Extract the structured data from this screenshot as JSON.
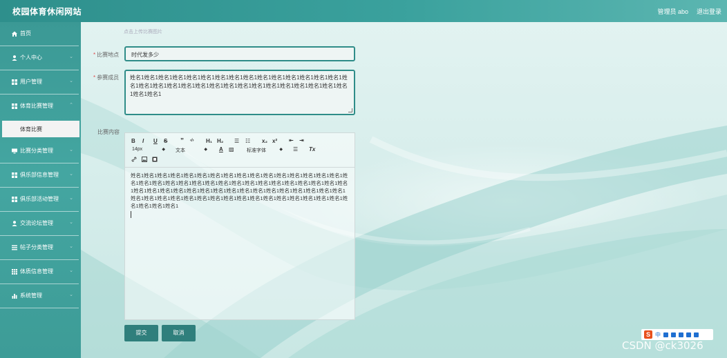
{
  "header": {
    "site_title": "校园体育休闲网站",
    "admin_label": "管理员 abo",
    "logout": "退出登录"
  },
  "sidebar": {
    "items": [
      {
        "label": "首页",
        "icon": "home-icon",
        "arrow": ""
      },
      {
        "label": "个人中心",
        "icon": "user-icon",
        "arrow": "⌄"
      },
      {
        "label": "用户管理",
        "icon": "grid-icon",
        "arrow": "⌄"
      },
      {
        "label": "体育比赛管理",
        "icon": "grid-icon",
        "arrow": "⌃"
      },
      {
        "label": "比赛分类管理",
        "icon": "monitor-icon",
        "arrow": "⌄"
      },
      {
        "label": "俱乐部信息管理",
        "icon": "grid-icon",
        "arrow": "⌄"
      },
      {
        "label": "俱乐部活动管理",
        "icon": "grid-icon",
        "arrow": "⌄"
      },
      {
        "label": "交流论坛管理",
        "icon": "user-icon",
        "arrow": "⌄"
      },
      {
        "label": "帖子分类管理",
        "icon": "list-icon",
        "arrow": "⌄"
      },
      {
        "label": "体质信息管理",
        "icon": "table-icon",
        "arrow": "⌄"
      },
      {
        "label": "系统管理",
        "icon": "chart-icon",
        "arrow": "⌄"
      }
    ],
    "submenu": "体育比赛"
  },
  "form": {
    "upload_hint": "点击上传比赛图片",
    "location_label": "比赛地点",
    "location_value": "时代发多少",
    "members_label": "参赛成员",
    "members_value": "姓名1姓名1姓名1姓名1姓名1姓名1姓名1姓名1姓名1姓名1姓名1姓名1姓名1姓名1姓名1姓名1姓名1姓名1姓名1姓名1姓名1姓名1姓名1姓名1姓名1姓名1姓名1姓名1姓名1姓名1姓名1姓名1姓名1",
    "content_label": "比赛内容",
    "content_value": "姓名1姓名1姓名1姓名1姓名1姓名1姓名1姓名1姓名1姓名1姓名1姓名1姓名1姓名1姓名1姓名1姓名1姓名1姓名1姓名1姓名1姓名1姓名1姓名1姓名1姓名1姓名1姓名1姓名1姓名1姓名1姓名1姓名1姓名1姓名1姓名1姓名1姓名1姓名1姓名1姓名1姓名1姓名1姓名1姓名1姓名1姓名1姓名1姓名1姓名1姓名1姓名1姓名1姓名1姓名1姓名1姓名1姓名1姓名1姓名1姓名1姓名1姓名1姓名1姓名1姓名1姓名1姓名1姓名1",
    "submit": "提交",
    "cancel": "取消"
  },
  "toolbar": {
    "bold": "B",
    "italic": "I",
    "underline": "U",
    "strike": "S",
    "quote": "”",
    "code": "‹/›",
    "h1": "H₁",
    "h2": "H₂",
    "ol": "☰",
    "ul": "☷",
    "sub": "x₂",
    "sup": "x²",
    "indent_left": "⇤",
    "indent_right": "⇥",
    "size": "14px",
    "text_style": "文本",
    "font": "标准字体",
    "color": "A",
    "bg": "▨",
    "align": "☰",
    "clear": "Tx"
  },
  "ime": {
    "lang": "中"
  },
  "watermark": "CSDN @ck3026"
}
